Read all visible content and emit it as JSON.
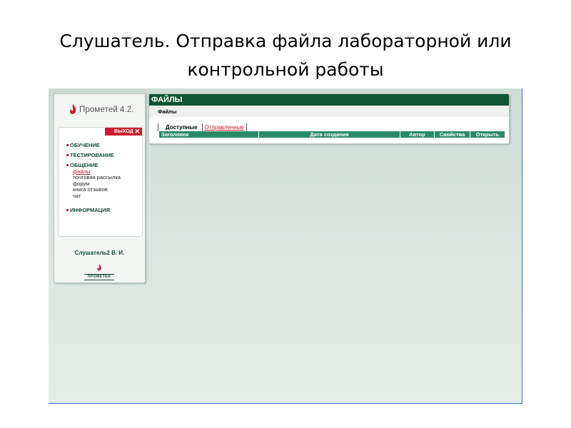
{
  "slide": {
    "title_line1": "Слушатель. Отправка файла лабораторной или",
    "title_line2": "контрольной работы"
  },
  "sidebar": {
    "logo_text": "Прометей 4.2.",
    "exit_label": "ВЫХОД",
    "exit_icon": "close-icon",
    "sections": [
      {
        "label": "ОБУЧЕНИЕ"
      },
      {
        "label": "ТЕСТИРОВАНИЕ"
      },
      {
        "label": "ОБЩЕНИЕ"
      },
      {
        "label": "ИНФОРМАЦИЯ"
      }
    ],
    "communication_items": [
      {
        "label": "файлы",
        "active": true
      },
      {
        "label": "почтовая рассылка"
      },
      {
        "label": "форум"
      },
      {
        "label": "книга отзывов"
      },
      {
        "label": "чат"
      }
    ],
    "user_name": "Слушатель2 В. И.",
    "footer_logo_text": "ПРОМЕТЕЙ"
  },
  "files": {
    "header": "ФАЙЛЫ",
    "subheader": "Файлы",
    "tabs": [
      {
        "label": "Доступные",
        "active": true
      },
      {
        "label": "Отправленные",
        "active": false
      }
    ],
    "columns": [
      "Заголовок",
      "Дата создания",
      "Автор",
      "Свойства",
      "Открыть"
    ]
  },
  "colors": {
    "brand_green": "#0d5533",
    "table_green": "#2a8a68",
    "accent_red": "#c8202e",
    "background": "#d6e1dc"
  }
}
